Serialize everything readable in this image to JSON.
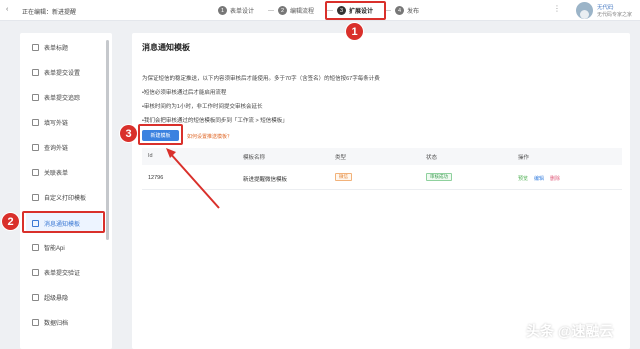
{
  "header": {
    "back_icon": "chevron-left-icon",
    "editing_label": "正在编辑：",
    "form_name": "新进提醒",
    "steps": [
      {
        "num": "1",
        "label": "表单设计"
      },
      {
        "num": "2",
        "label": "编辑流程"
      },
      {
        "num": "3",
        "label": "扩展设计"
      },
      {
        "num": "4",
        "label": "发布"
      }
    ],
    "active_step": "扩展设计",
    "more_icon": "more-dots-icon",
    "user_name": "无代码",
    "user_role": "无代码专家之家"
  },
  "sidebar": {
    "items": [
      {
        "label": "表单标题",
        "icon": "title-icon"
      },
      {
        "label": "表单提交设置",
        "icon": "settings-icon"
      },
      {
        "label": "表单提交追踪",
        "icon": "eye-icon"
      },
      {
        "label": "填写外链",
        "icon": "link-icon"
      },
      {
        "label": "查询外链",
        "icon": "link-icon"
      },
      {
        "label": "关联表单",
        "icon": "relation-icon"
      },
      {
        "label": "自定义打印模板",
        "icon": "print-icon"
      },
      {
        "label": "消息通知模板",
        "icon": "message-icon"
      },
      {
        "label": "智能Api",
        "icon": "api-icon"
      },
      {
        "label": "表单提交验证",
        "icon": "check-icon"
      },
      {
        "label": "超级悬隐",
        "icon": "hide-icon"
      },
      {
        "label": "数据归档",
        "icon": "archive-icon"
      }
    ],
    "active_item": "消息通知模板"
  },
  "main": {
    "title": "消息通知模板",
    "notice_lines": [
      "为保证短信的稳定推送，以下内容须审核后才能使用。多于70字（含签名）的短信按67字每条计费",
      "•短信必须审核通过后才能启用流程",
      "•审核时间约为1小时，非工作时间提交审核会延长",
      "•我们会把审核通过的短信模板同步到「工作流 > 短信模板」"
    ],
    "new_button_label": "新建模板",
    "howto_link": "如何设置推送模板？",
    "table": {
      "columns": [
        "Id",
        "模板名称",
        "类型",
        "状态",
        "操作"
      ],
      "rows": [
        {
          "id": "12796",
          "name": "新进提醒微信模板",
          "type": "微信",
          "status": "审核成功",
          "actions": [
            "预览",
            "编辑",
            "删除"
          ]
        }
      ]
    }
  },
  "annotations": {
    "badges": [
      "1",
      "2",
      "3"
    ],
    "highlight_color": "#d9302b"
  },
  "watermark": "头条 @速融云",
  "colors": {
    "accent": "#3b82e0",
    "annotation_red": "#d9302b",
    "type_tag": "#e07d2a",
    "status_tag": "#3a9b4f"
  }
}
